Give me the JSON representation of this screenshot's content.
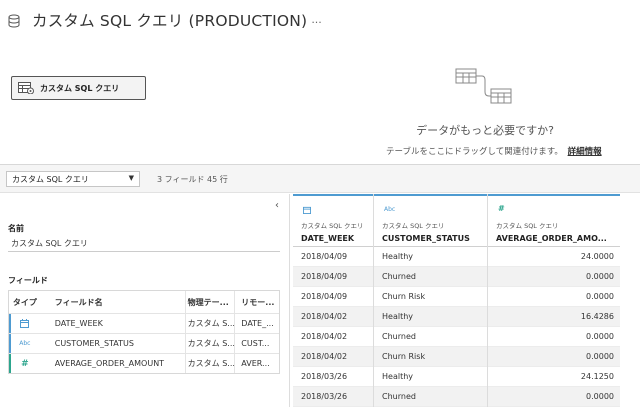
{
  "header": {
    "title": "カスタム SQL クエリ (PRODUCTION)",
    "more": "···"
  },
  "canvas": {
    "table_label": "カスタム SQL クエリ",
    "need_more": "データがもっと必要ですか?",
    "drag_hint": "テーブルをここにドラッグして関連付けます。",
    "learn_more": "詳細情報"
  },
  "toolbar": {
    "selected": "カスタム SQL クエリ",
    "count": "3 フィールド 45 行"
  },
  "details": {
    "name_label": "名前",
    "name_value": "カスタム SQL クエリ",
    "fields_label": "フィールド",
    "columns": [
      "タイプ",
      "フィールド名",
      "物理テー...",
      "リモー..."
    ],
    "rows": [
      {
        "type_icon": "calendar-icon",
        "name": "DATE_WEEK",
        "table": "カスタム S...",
        "remote": "DATE_..."
      },
      {
        "type_icon": "abc-string-icon",
        "name": "CUSTOMER_STATUS",
        "table": "カスタム S...",
        "remote": "CUST..."
      },
      {
        "type_icon": "number-hash-icon",
        "name": "AVERAGE_ORDER_AMOUNT",
        "table": "カスタム S...",
        "remote": "AVER..."
      }
    ]
  },
  "grid": {
    "columns": [
      {
        "icon_text": "",
        "source": "カスタム SQL クエリ",
        "name": "DATE_WEEK"
      },
      {
        "icon_text": "Abc",
        "source": "カスタム SQL クエリ",
        "name": "CUSTOMER_STATUS"
      },
      {
        "icon_text": "#",
        "source": "カスタム SQL クエリ",
        "name": "AVERAGE_ORDER_AMO..."
      }
    ],
    "rows": [
      [
        "2018/04/09",
        "Healthy",
        "24.0000"
      ],
      [
        "2018/04/09",
        "Churned",
        "0.0000"
      ],
      [
        "2018/04/09",
        "Churn Risk",
        "0.0000"
      ],
      [
        "2018/04/02",
        "Healthy",
        "16.4286"
      ],
      [
        "2018/04/02",
        "Churned",
        "0.0000"
      ],
      [
        "2018/04/02",
        "Churn Risk",
        "0.0000"
      ],
      [
        "2018/03/26",
        "Healthy",
        "24.1250"
      ],
      [
        "2018/03/26",
        "Churned",
        "0.0000"
      ]
    ]
  },
  "colors": {
    "accent": "#4e9bd1",
    "number": "#2ca58d"
  }
}
